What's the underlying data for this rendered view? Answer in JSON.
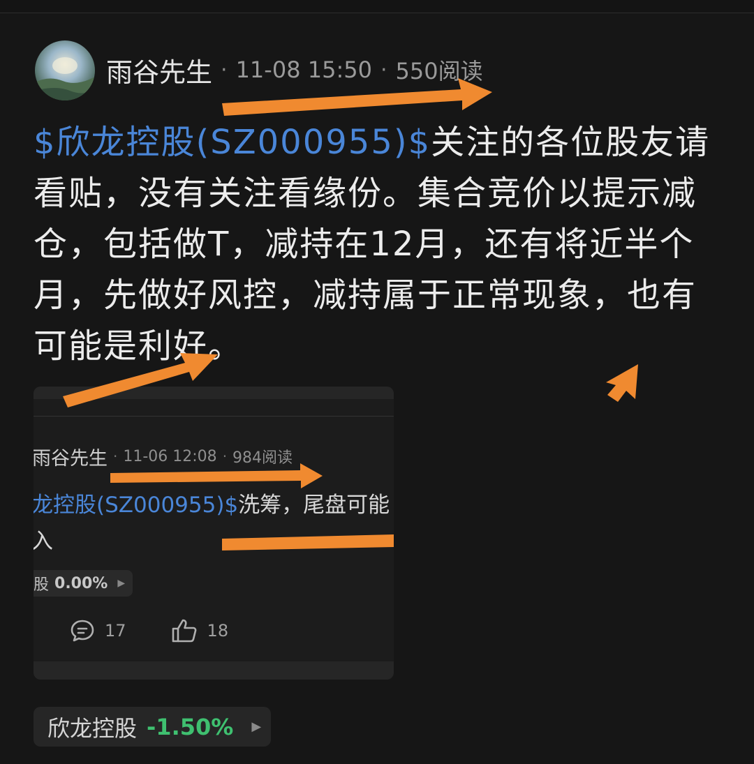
{
  "post": {
    "author": "雨谷先生",
    "date": "11-08 15:50",
    "reads": "550阅读",
    "separator": "·",
    "stock_link": "$欣龙控股(SZ000955)$",
    "body_text": "关注的各位股友请看贴，没有关注看缘份。集合竞价以提示减仓，包括做T，减持在12月，还有将近半个月，先做好风控，减持属于正常现象，也有可能是利好。"
  },
  "quoted_post": {
    "author": "雨谷先生",
    "date": "11-06 12:08",
    "reads": "984阅读",
    "separator": "·",
    "stock_link": "龙控股(SZ000955)$",
    "body_line1": "洗筹，尾盘可能",
    "body_line2": "入",
    "tag_name": "股",
    "tag_pct": "0.00%",
    "comments": "17",
    "likes": "18"
  },
  "stock_tag": {
    "name": "欣龙控股",
    "change": "-1.50%",
    "change_color": "#3fc070"
  },
  "colors": {
    "background": "#161616",
    "link": "#4a86d8",
    "annotation_arrow": "#f08a30"
  },
  "icons": {
    "comment": "comment-icon",
    "like": "thumbs-up-icon",
    "arrow": "play-arrow-icon"
  }
}
